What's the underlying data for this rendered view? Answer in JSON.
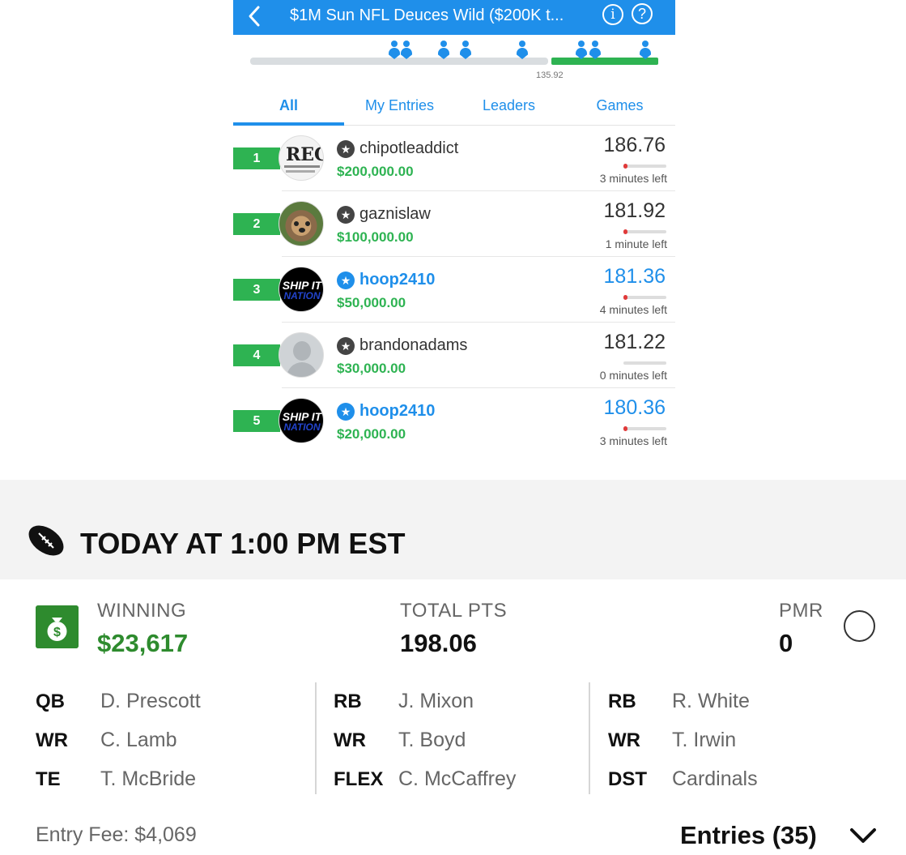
{
  "header": {
    "title": "$1M Sun NFL Deuces Wild ($200K t...",
    "back_icon": "chevron-left-icon",
    "info_glyph": "i",
    "help_glyph": "?"
  },
  "progress": {
    "score_marker": "135.92"
  },
  "tabs": [
    {
      "label": "All",
      "active": true
    },
    {
      "label": "My Entries",
      "active": false
    },
    {
      "label": "Leaders",
      "active": false
    },
    {
      "label": "Games",
      "active": false
    }
  ],
  "leaderboard": [
    {
      "rank": "1",
      "username": "chipotleaddict",
      "prize": "$200,000.00",
      "points": "186.76",
      "time_left": "3 minutes left",
      "highlight": false
    },
    {
      "rank": "2",
      "username": "gaznislaw",
      "prize": "$100,000.00",
      "points": "181.92",
      "time_left": "1 minute left",
      "highlight": false
    },
    {
      "rank": "3",
      "username": "hoop2410",
      "prize": "$50,000.00",
      "points": "181.36",
      "time_left": "4 minutes left",
      "highlight": true
    },
    {
      "rank": "4",
      "username": "brandonadams",
      "prize": "$30,000.00",
      "points": "181.22",
      "time_left": "0 minutes left",
      "highlight": false
    },
    {
      "rank": "5",
      "username": "hoop2410",
      "prize": "$20,000.00",
      "points": "180.36",
      "time_left": "3 minutes left",
      "highlight": true
    }
  ],
  "avatars": {
    "reg_text": "REG",
    "ship_line1": "SHIP IT",
    "ship_line2": "NATION"
  },
  "game": {
    "title": "TODAY AT 1:00 PM EST"
  },
  "summary": {
    "winning_label": "WINNING",
    "winning_value": "$23,617",
    "total_label": "TOTAL PTS",
    "total_value": "198.06",
    "pmr_label": "PMR",
    "pmr_value": "0"
  },
  "lineup": [
    {
      "pos": "QB",
      "player": "D. Prescott"
    },
    {
      "pos": "WR",
      "player": "C. Lamb"
    },
    {
      "pos": "TE",
      "player": "T. McBride"
    },
    {
      "pos": "RB",
      "player": "J. Mixon"
    },
    {
      "pos": "WR",
      "player": "T. Boyd"
    },
    {
      "pos": "FLEX",
      "player": "C. McCaffrey"
    },
    {
      "pos": "RB",
      "player": "R. White"
    },
    {
      "pos": "WR",
      "player": "T. Irwin"
    },
    {
      "pos": "DST",
      "player": "Cardinals"
    }
  ],
  "footer": {
    "entry_fee": "Entry Fee: $4,069",
    "entries": "Entries (35)"
  },
  "colors": {
    "brand_blue": "#1f8fea",
    "green": "#2eb352",
    "money_green": "#2e8b2e"
  }
}
